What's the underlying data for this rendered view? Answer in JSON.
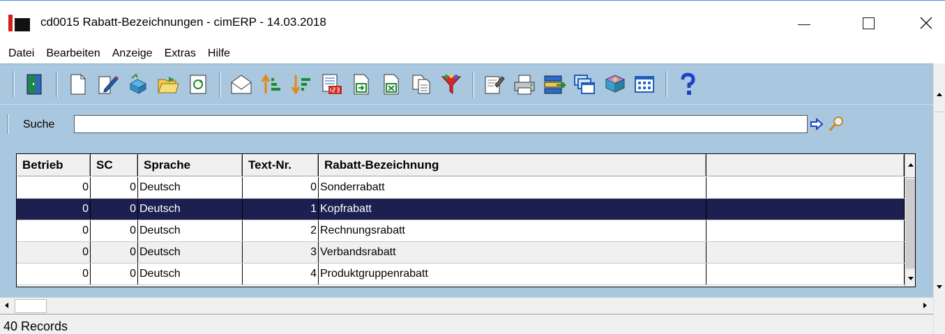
{
  "window": {
    "title": "cd0015 Rabatt-Bezeichnungen - cimERP - 14.03.2018"
  },
  "menu": {
    "items": [
      "Datei",
      "Bearbeiten",
      "Anzeige",
      "Extras",
      "Hilfe"
    ]
  },
  "toolbar": {
    "icons": [
      "exit-icon",
      "new-document-icon",
      "edit-icon",
      "copy-icon",
      "open-icon",
      "refresh-icon",
      "email-icon",
      "sort-ascending-icon",
      "sort-descending-icon",
      "numbering-icon",
      "export-icon",
      "excel-export-icon",
      "copy-pages-icon",
      "filter-icon",
      "properties-icon",
      "print-icon",
      "transfer-icon",
      "windows-icon",
      "book-icon",
      "grid-view-icon",
      "help-icon"
    ]
  },
  "search": {
    "label": "Suche",
    "value": ""
  },
  "grid": {
    "columns": [
      "Betrieb",
      "SC",
      "Sprache",
      "Text-Nr.",
      "Rabatt-Bezeichnung",
      ""
    ],
    "rows": [
      {
        "betrieb": "0",
        "sc": "0",
        "sprache": "Deutsch",
        "text_nr": "0",
        "bezeichnung": "Sonderrabatt",
        "extra": ""
      },
      {
        "betrieb": "0",
        "sc": "0",
        "sprache": "Deutsch",
        "text_nr": "1",
        "bezeichnung": "Kopfrabatt",
        "extra": ""
      },
      {
        "betrieb": "0",
        "sc": "0",
        "sprache": "Deutsch",
        "text_nr": "2",
        "bezeichnung": "Rechnungsrabatt",
        "extra": ""
      },
      {
        "betrieb": "0",
        "sc": "0",
        "sprache": "Deutsch",
        "text_nr": "3",
        "bezeichnung": "Verbandsrabatt",
        "extra": ""
      },
      {
        "betrieb": "0",
        "sc": "0",
        "sprache": "Deutsch",
        "text_nr": "4",
        "bezeichnung": "Produktgruppenrabatt",
        "extra": ""
      }
    ],
    "selected_row": 1
  },
  "status": {
    "text": "40 Records"
  },
  "colors": {
    "toolbar_bg": "#a9c7de",
    "selection_bg": "#1c1f4f",
    "app_icon_red": "#d0201a"
  }
}
